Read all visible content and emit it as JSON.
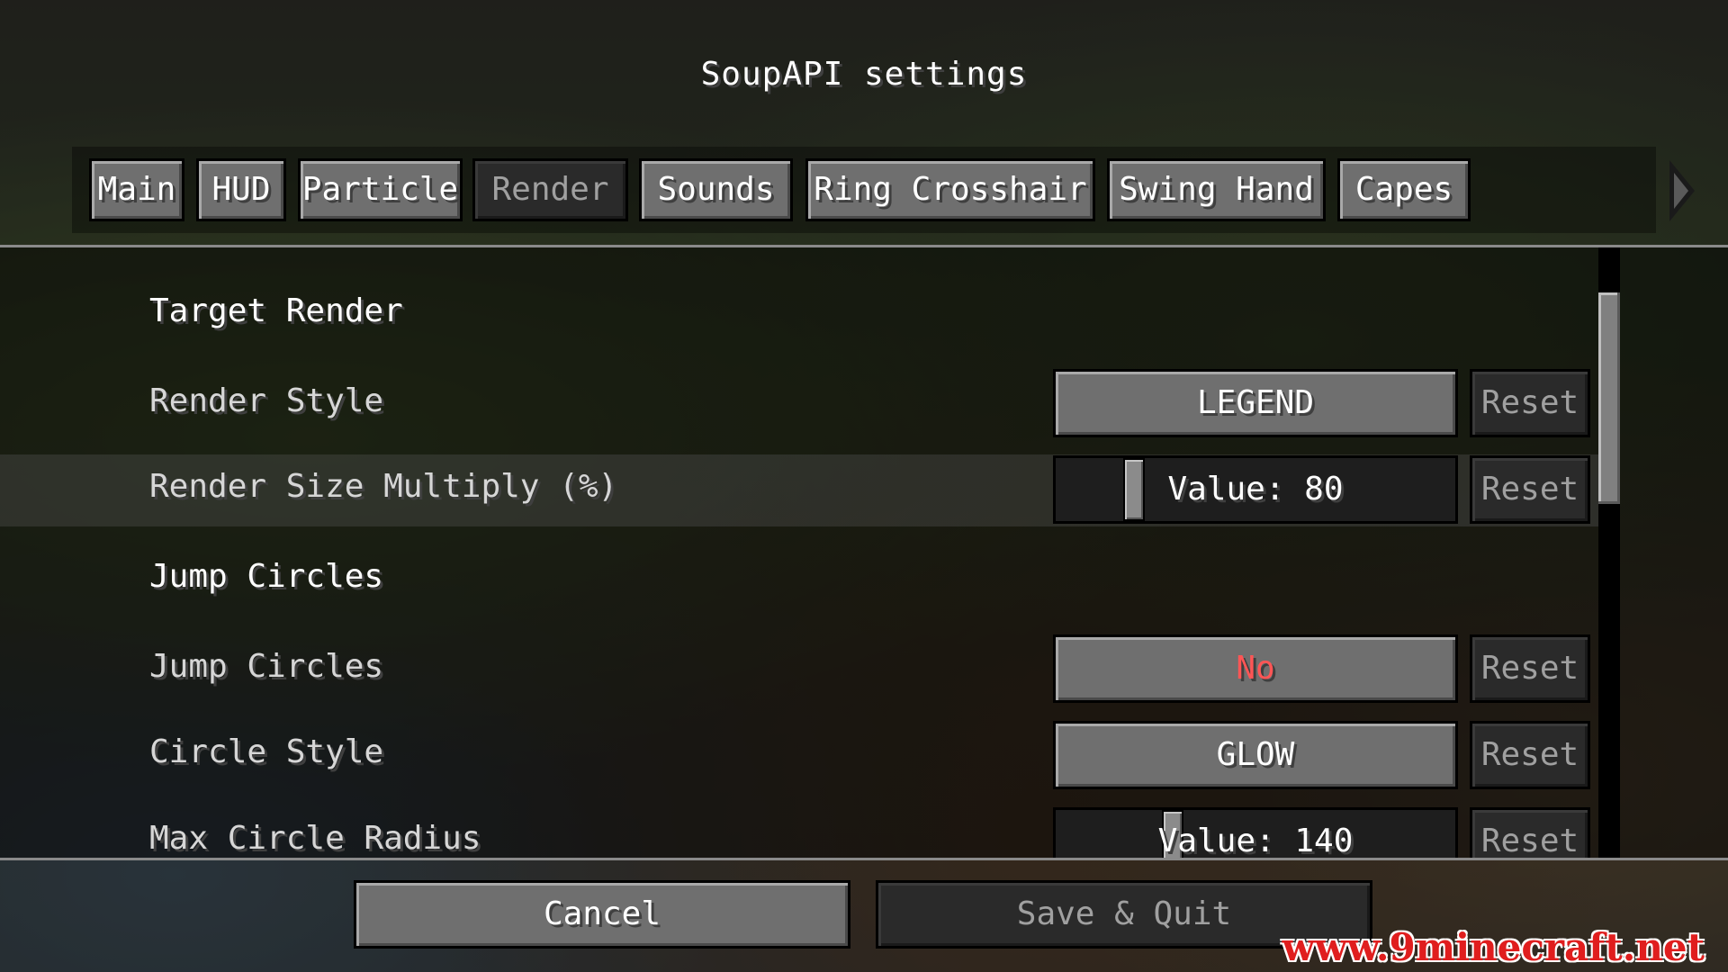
{
  "title": "SoupAPI settings",
  "tabs": [
    {
      "label": "Main",
      "active": false
    },
    {
      "label": "HUD",
      "active": false
    },
    {
      "label": "Particle",
      "active": false
    },
    {
      "label": "Render",
      "active": true
    },
    {
      "label": "Sounds",
      "active": false
    },
    {
      "label": "Ring Crosshair",
      "active": false
    },
    {
      "label": "Swing Hand",
      "active": false
    },
    {
      "label": "Capes",
      "active": false
    }
  ],
  "tab_next_icon": "triangle-right-icon",
  "sections": {
    "target_render": {
      "title": "Target Render",
      "render_style": {
        "label": "Render Style",
        "value": "LEGEND",
        "reset": "Reset"
      },
      "render_size": {
        "label": "Render Size Multiply (%)",
        "value_text": "Value: 80",
        "value": 80,
        "reset": "Reset"
      }
    },
    "jump_circles": {
      "title": "Jump Circles",
      "jump_circles": {
        "label": "Jump Circles",
        "value": "No",
        "reset": "Reset"
      },
      "circle_style": {
        "label": "Circle Style",
        "value": "GLOW",
        "reset": "Reset"
      },
      "max_circle_radius": {
        "label": "Max Circle Radius",
        "value_text": "Value: 140",
        "value": 140,
        "reset": "Reset"
      }
    }
  },
  "footer": {
    "cancel": "Cancel",
    "save_quit": "Save & Quit"
  },
  "watermark": "www.9minecraft.net",
  "colors": {
    "off_value": "#ff5555",
    "watermark": "#e01e1e"
  }
}
